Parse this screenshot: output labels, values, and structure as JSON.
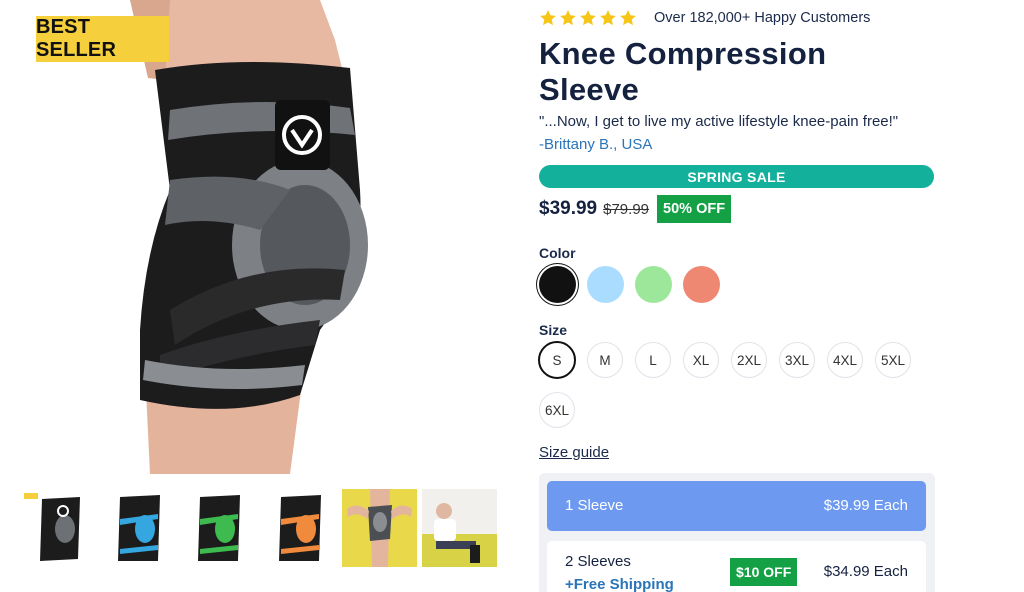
{
  "gallery": {
    "badge": "BEST SELLER",
    "main_image": "knee sleeve on leg",
    "thumbnails": [
      {
        "name": "black-grey sleeve",
        "accent": "#8a8f96"
      },
      {
        "name": "blue sleeve",
        "accent": "#34a6e0"
      },
      {
        "name": "green sleeve",
        "accent": "#3dbb4f"
      },
      {
        "name": "orange sleeve",
        "accent": "#f08a3c"
      },
      {
        "name": "sleeve on yellow background",
        "accent": "#e8d84a"
      },
      {
        "name": "man on sofa wearing sleeve",
        "accent": "#d8d346"
      }
    ]
  },
  "rating": {
    "stars": 5,
    "star_color": "#f5c518",
    "text": "Over 182,000+ Happy Customers"
  },
  "product": {
    "title": "Knee Compression Sleeve",
    "quote": "\"...Now, I get to live my active lifestyle knee-pain free!\"",
    "author": "-Brittany B., USA"
  },
  "sale": {
    "banner": "SPRING SALE",
    "price": "$39.99",
    "compare_price": "$79.99",
    "discount": "50% OFF"
  },
  "color": {
    "label": "Color",
    "options": [
      {
        "name": "black",
        "hex": "#111111",
        "selected": true
      },
      {
        "name": "light-blue",
        "hex": "#a9dcff",
        "selected": false
      },
      {
        "name": "green",
        "hex": "#9de79b",
        "selected": false
      },
      {
        "name": "salmon",
        "hex": "#ef8872",
        "selected": false
      }
    ]
  },
  "size": {
    "label": "Size",
    "options": [
      "S",
      "M",
      "L",
      "XL",
      "2XL",
      "3XL",
      "4XL",
      "5XL",
      "6XL"
    ],
    "selected": "S",
    "guide_link": "Size guide"
  },
  "bundles": [
    {
      "name": "1 Sleeve",
      "price": "$39.99 Each",
      "selected": true,
      "accent": "#6d99f0"
    },
    {
      "name": "2 Sleeves",
      "sub": "+Free Shipping",
      "badge": "$10 OFF",
      "price": "$34.99 Each",
      "selected": false
    }
  ]
}
